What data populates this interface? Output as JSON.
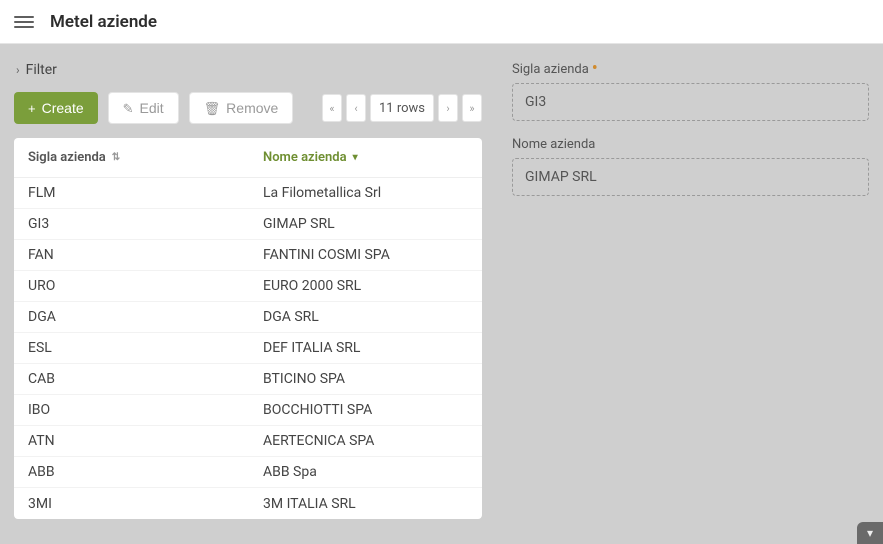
{
  "header": {
    "title": "Metel aziende"
  },
  "filter": {
    "label": "Filter"
  },
  "toolbar": {
    "create_label": "Create",
    "edit_label": "Edit",
    "remove_label": "Remove"
  },
  "pager": {
    "rowcount": "11 rows"
  },
  "table": {
    "columns": {
      "sigla": "Sigla azienda",
      "nome": "Nome azienda"
    },
    "rows": [
      {
        "sigla": "FLM",
        "nome": "La Filometallica Srl"
      },
      {
        "sigla": "GI3",
        "nome": "GIMAP SRL"
      },
      {
        "sigla": "FAN",
        "nome": "FANTINI COSMI SPA"
      },
      {
        "sigla": "URO",
        "nome": "EURO 2000 SRL"
      },
      {
        "sigla": "DGA",
        "nome": "DGA SRL"
      },
      {
        "sigla": "ESL",
        "nome": "DEF ITALIA SRL"
      },
      {
        "sigla": "CAB",
        "nome": "BTICINO SPA"
      },
      {
        "sigla": "IBO",
        "nome": "BOCCHIOTTI SPA"
      },
      {
        "sigla": "ATN",
        "nome": "AERTECNICA SPA"
      },
      {
        "sigla": "ABB",
        "nome": "ABB Spa"
      },
      {
        "sigla": "3MI",
        "nome": "3M ITALIA SRL"
      }
    ]
  },
  "detail": {
    "sigla_label": "Sigla azienda",
    "sigla_value": "GI3",
    "nome_label": "Nome azienda",
    "nome_value": "GIMAP SRL"
  }
}
